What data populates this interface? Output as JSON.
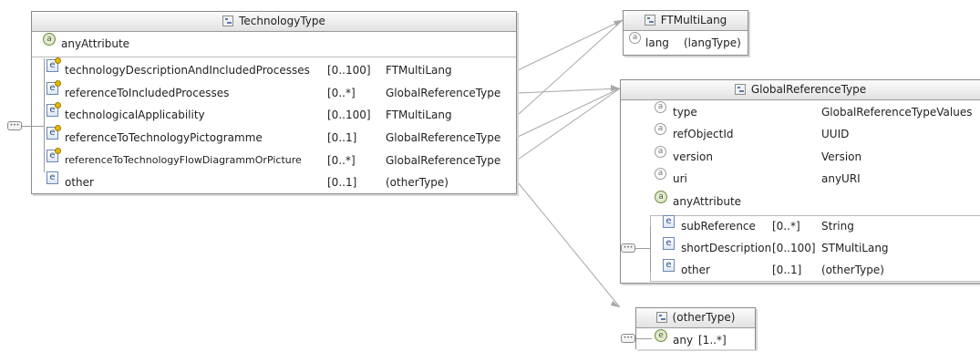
{
  "technology_type": {
    "title": "TechnologyType",
    "any_attribute": "anyAttribute",
    "elements": [
      {
        "name": "technologyDescriptionAndIncludedProcesses",
        "card": "[0..100]",
        "type": "FTMultiLang"
      },
      {
        "name": "referenceToIncludedProcesses",
        "card": "[0..*]",
        "type": "GlobalReferenceType"
      },
      {
        "name": "technologicalApplicability",
        "card": "[0..100]",
        "type": "FTMultiLang"
      },
      {
        "name": "referenceToTechnologyPictogramme",
        "card": "[0..1]",
        "type": "GlobalReferenceType"
      },
      {
        "name": "referenceToTechnologyFlowDiagrammOrPicture",
        "card": "[0..*]",
        "type": "GlobalReferenceType"
      },
      {
        "name": "other",
        "card": "[0..1]",
        "type": "(otherType)"
      }
    ]
  },
  "ft_multilang": {
    "title": "FTMultiLang",
    "attr": {
      "name": "lang",
      "type": "(langType)"
    }
  },
  "global_reference_type": {
    "title": "GlobalReferenceType",
    "attributes": [
      {
        "name": "type",
        "type": "GlobalReferenceTypeValues"
      },
      {
        "name": "refObjectId",
        "type": "UUID"
      },
      {
        "name": "version",
        "type": "Version"
      },
      {
        "name": "uri",
        "type": "anyURI"
      }
    ],
    "any_attribute": "anyAttribute",
    "elements": [
      {
        "name": "subReference",
        "card": "[0..*]",
        "type": "String"
      },
      {
        "name": "shortDescription",
        "card": "[0..100]",
        "type": "STMultiLang"
      },
      {
        "name": "other",
        "card": "[0..1]",
        "type": "(otherType)"
      }
    ]
  },
  "other_type": {
    "title": "(otherType)",
    "any": {
      "name": "any",
      "card": "[1..*]"
    }
  }
}
